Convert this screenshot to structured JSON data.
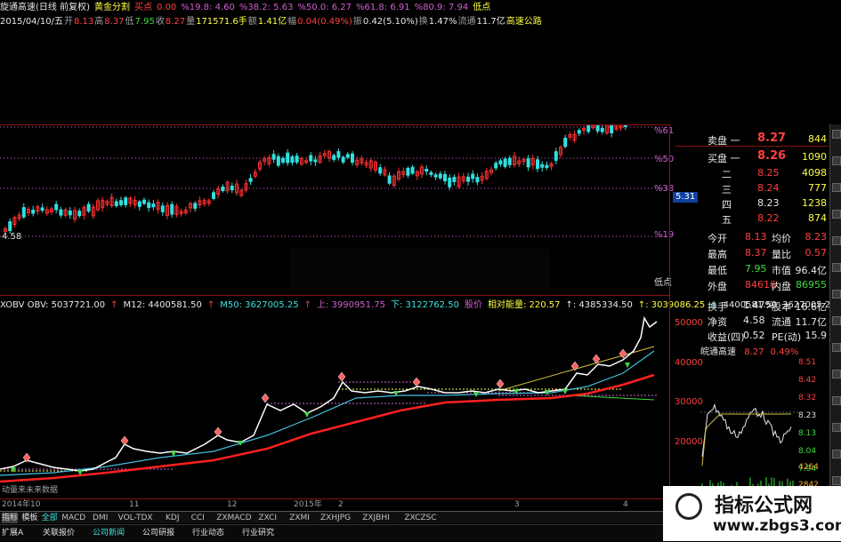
{
  "header": {
    "line1": [
      {
        "t": "旋通高速(日线 前复权)",
        "c": "white"
      },
      {
        "t": "黄金分割",
        "c": "yellow"
      },
      {
        "t": "买点",
        "c": "red"
      },
      {
        "t": "0.00",
        "c": "red"
      },
      {
        "t": "%19.8: 4.60",
        "c": "mag"
      },
      {
        "t": "%38.2: 5.63",
        "c": "mag"
      },
      {
        "t": "%50.0: 6.27",
        "c": "mag"
      },
      {
        "t": "%61.8: 6.91",
        "c": "mag"
      },
      {
        "t": "%80.9: 7.94",
        "c": "mag"
      },
      {
        "t": "低点",
        "c": "yellow"
      }
    ],
    "line2": [
      {
        "t": "2015/04/10/五",
        "c": "white"
      },
      {
        "t": "开",
        "c": "gray"
      },
      {
        "t": "8.13",
        "c": "red"
      },
      {
        "t": "高",
        "c": "gray"
      },
      {
        "t": "8.37",
        "c": "red"
      },
      {
        "t": "低",
        "c": "gray"
      },
      {
        "t": "7.95",
        "c": "green"
      },
      {
        "t": "收",
        "c": "gray"
      },
      {
        "t": "8.27",
        "c": "red"
      },
      {
        "t": "量",
        "c": "gray"
      },
      {
        "t": "171571.6手",
        "c": "yellow"
      },
      {
        "t": "额",
        "c": "gray"
      },
      {
        "t": "1.41亿",
        "c": "yellow"
      },
      {
        "t": "幅",
        "c": "gray"
      },
      {
        "t": "0.04(0.49%)",
        "c": "red"
      },
      {
        "t": "振",
        "c": "gray"
      },
      {
        "t": "0.42(5.10%)",
        "c": "white"
      },
      {
        "t": "换",
        "c": "gray"
      },
      {
        "t": "1.47%",
        "c": "white"
      },
      {
        "t": "流通",
        "c": "gray"
      },
      {
        "t": "11.7亿",
        "c": "white"
      },
      {
        "t": "高速公路",
        "c": "yellow"
      }
    ]
  },
  "main_chart": {
    "fib_labels": [
      "%61",
      "%50",
      "%38",
      "%19"
    ],
    "price_low_label": "4.58",
    "cur_price_tag": "5.31",
    "low_point_label": "低点"
  },
  "obv_header": [
    {
      "t": "XOBV OBV: 5037721.00",
      "c": "white"
    },
    {
      "t": "↑",
      "c": "red"
    },
    {
      "t": "M12: 4400581.50",
      "c": "white"
    },
    {
      "t": "↑",
      "c": "red"
    },
    {
      "t": "M50: 3627005.25",
      "c": "cyan"
    },
    {
      "t": "↑",
      "c": "red"
    },
    {
      "t": "上: 3990951.75",
      "c": "mag"
    },
    {
      "t": "下: 3122762.50",
      "c": "cyan"
    },
    {
      "t": "股价",
      "c": "mag"
    },
    {
      "t": "相对能量: 220.57",
      "c": "yellow"
    },
    {
      "t": "↑: 4385334.50",
      "c": "white"
    },
    {
      "t": "↑: 3039086.25",
      "c": "yellow"
    },
    {
      "t": "↓",
      "c": "cyan"
    },
    {
      "t": "4400581.50",
      "c": "white"
    },
    {
      "t": "3627005.25",
      "c": "white"
    }
  ],
  "obv_axis": [
    "50000",
    "40000",
    "30000",
    "20000"
  ],
  "time_axis": [
    "2014年",
    "10",
    "11",
    "12",
    "2015年",
    "2",
    "3",
    "4"
  ],
  "bottom_label": "动量来未来数据",
  "tabs": [
    "指标",
    "模板",
    "全部",
    "MACD",
    "DMI",
    "VOL-TDX",
    "KDJ",
    "CCI",
    "ZXMACD",
    "ZXCI",
    "ZXMI",
    "ZXHJPG",
    "ZXJBHI",
    "ZXCZSC"
  ],
  "links": [
    "扩展A",
    "关联报价",
    "公司新闻",
    "公司研报",
    "行业动态",
    "行业研究"
  ],
  "quote": {
    "sell1": {
      "label": "卖盘 一",
      "price": "8.27",
      "vol": "844"
    },
    "buy1": {
      "label": "买盘 一",
      "price": "8.26",
      "vol": "1090"
    },
    "buys": [
      {
        "label": "二",
        "price": "8.25",
        "vol": "4098"
      },
      {
        "label": "三",
        "price": "8.24",
        "vol": "777"
      },
      {
        "label": "四",
        "price": "8.23",
        "vol": "1238"
      },
      {
        "label": "五",
        "price": "8.22",
        "vol": "874"
      }
    ],
    "stats": [
      {
        "l1": "今开",
        "v1": "8.13",
        "c1": "red",
        "l2": "均价",
        "v2": "8.23",
        "c2": "red"
      },
      {
        "l1": "最高",
        "v1": "8.37",
        "c1": "red",
        "l2": "量比",
        "v2": "0.57",
        "c2": "red"
      },
      {
        "l1": "最低",
        "v1": "7.95",
        "c1": "green",
        "l2": "市值",
        "v2": "96.4亿",
        "c2": "white"
      },
      {
        "l1": "外盘",
        "v1": "84616",
        "c1": "red",
        "l2": "内盘",
        "v2": "86955",
        "c2": "green"
      }
    ],
    "stats2": [
      {
        "l1": "换手",
        "v1": "1.47%",
        "l2": "股本",
        "v2": "16.6亿"
      },
      {
        "l1": "净资",
        "v1": "4.58",
        "l2": "流通",
        "v2": "11.7亿"
      },
      {
        "l1": "收益(四)",
        "v1": "0.52",
        "l2": "PE(动)",
        "v2": "15.9"
      }
    ],
    "mini_title": "皖通高速",
    "mini_price": "8.27",
    "mini_pct": "0.49%",
    "mini_axis": [
      "8.51",
      "8.42",
      "8.32",
      "8.23",
      "8.13",
      "8.04",
      "7.94"
    ],
    "mini_vol_axis": [
      "4264",
      "2842"
    ]
  },
  "watermark": {
    "title": "指标公式网",
    "url": "www.zbgs3.com"
  },
  "colors": {
    "up": "#ff3030",
    "down": "#30e0e0",
    "obv": "#ffffff",
    "m12": "#40c0e0",
    "m50": "#ff2020",
    "fib": "#d060d0"
  }
}
